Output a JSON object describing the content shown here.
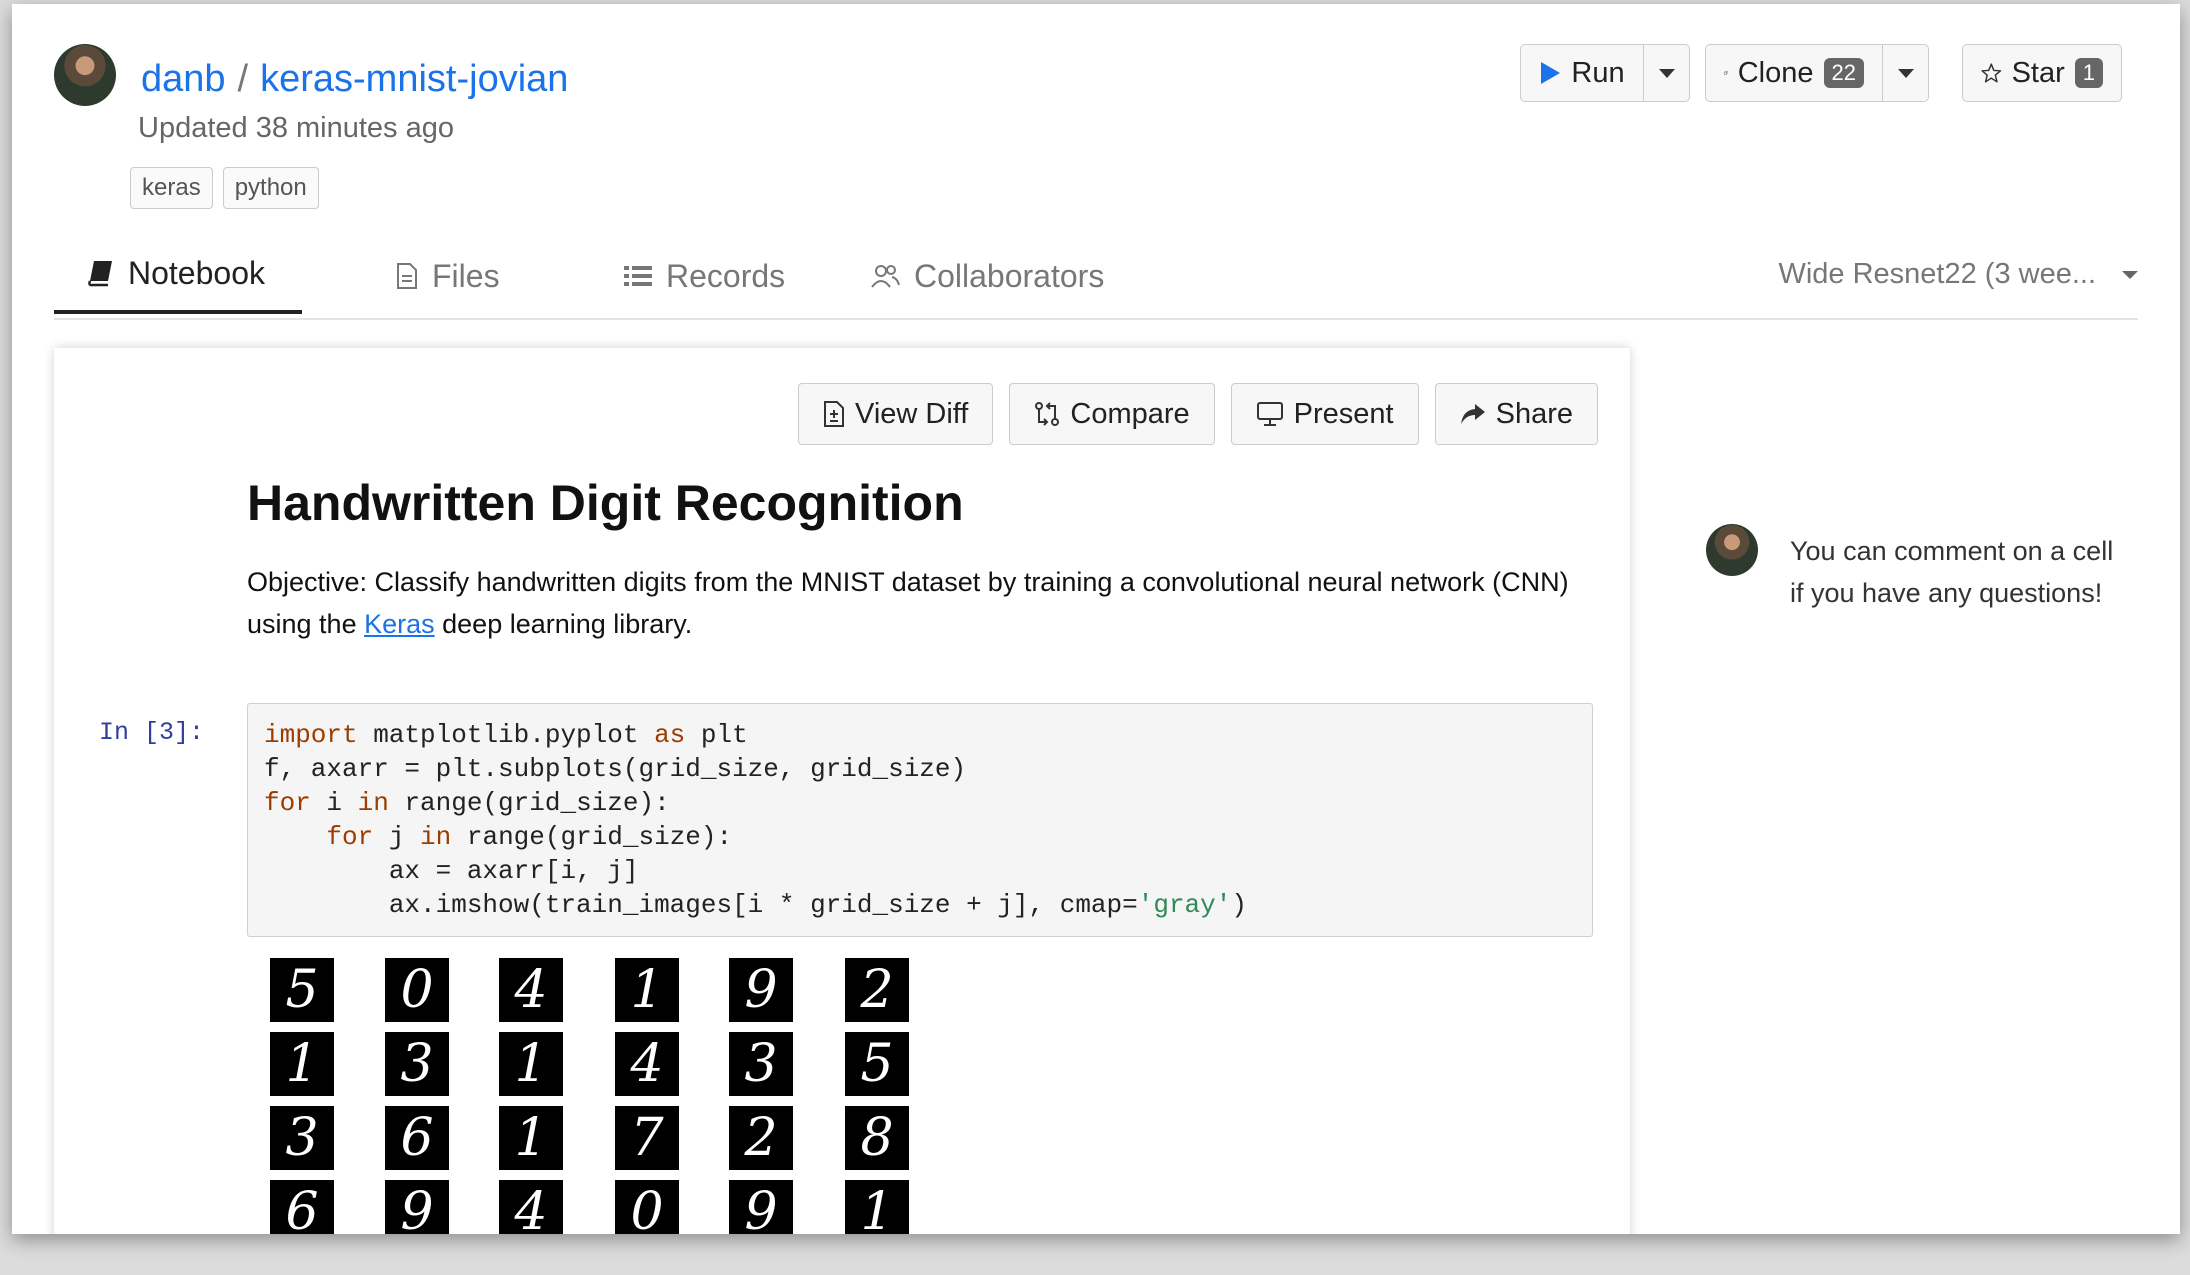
{
  "header": {
    "owner": "danb",
    "separator": "/",
    "repo": "keras-mnist-jovian",
    "updated": "Updated 38 minutes ago",
    "tags": [
      "keras",
      "python"
    ]
  },
  "actions": {
    "run_label": "Run",
    "clone_label": "Clone",
    "clone_count": "22",
    "star_label": "Star",
    "star_count": "1"
  },
  "tabs": [
    {
      "label": "Notebook",
      "icon": "book-icon",
      "active": true
    },
    {
      "label": "Files",
      "icon": "file-icon",
      "active": false
    },
    {
      "label": "Records",
      "icon": "list-icon",
      "active": false
    },
    {
      "label": "Collaborators",
      "icon": "users-icon",
      "active": false
    }
  ],
  "version_selector": "Wide Resnet22 (3 wee...",
  "toolbar": {
    "view_diff": "View Diff",
    "compare": "Compare",
    "present": "Present",
    "share": "Share"
  },
  "notebook": {
    "title": "Handwritten Digit Recognition",
    "desc_before": "Objective: Classify handwritten digits from the MNIST dataset by training a convolutional neural network (CNN) using the ",
    "desc_link": "Keras",
    "desc_after": " deep learning library.",
    "prompt": "In [3]:",
    "code_lines": [
      [
        {
          "t": "import",
          "c": "kw"
        },
        {
          "t": " matplotlib.pyplot "
        },
        {
          "t": "as",
          "c": "kw"
        },
        {
          "t": " plt"
        }
      ],
      [
        {
          "t": "f, axarr = plt.subplots(grid_size, grid_size)"
        }
      ],
      [
        {
          "t": "for",
          "c": "kw"
        },
        {
          "t": " i "
        },
        {
          "t": "in",
          "c": "kw"
        },
        {
          "t": " range(grid_size):"
        }
      ],
      [
        {
          "t": "    "
        },
        {
          "t": "for",
          "c": "kw"
        },
        {
          "t": " j "
        },
        {
          "t": "in",
          "c": "kw"
        },
        {
          "t": " range(grid_size):"
        }
      ],
      [
        {
          "t": "        ax = axarr[i, j]"
        }
      ],
      [
        {
          "t": "        ax.imshow(train_images[i * grid_size + j], cmap="
        },
        {
          "t": "'gray'",
          "c": "str"
        },
        {
          "t": ")"
        }
      ]
    ],
    "digit_rows": [
      [
        "5",
        "0",
        "4",
        "1",
        "9",
        "2"
      ],
      [
        "1",
        "3",
        "1",
        "4",
        "3",
        "5"
      ],
      [
        "3",
        "6",
        "1",
        "7",
        "2",
        "8"
      ],
      [
        "6",
        "9",
        "4",
        "0",
        "9",
        "1"
      ]
    ]
  },
  "comment_hint": "You can comment on a cell if you have any questions!"
}
